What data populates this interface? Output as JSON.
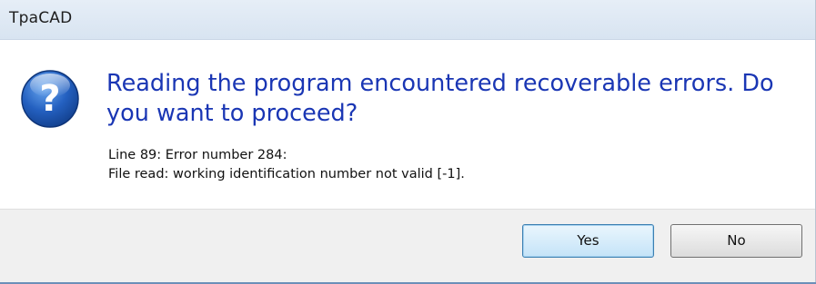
{
  "window": {
    "title": "TpaCAD"
  },
  "message": {
    "icon": "question-icon",
    "main_instruction": "Reading the program encountered recoverable errors. Do you want to proceed?",
    "details": [
      "Line 89: Error number 284:",
      "File read: working identification number not valid [-1]."
    ]
  },
  "buttons": {
    "yes_label": "Yes",
    "no_label": "No"
  },
  "colors": {
    "instruction_text": "#1a36b4",
    "titlebar": "#dce6f2",
    "footer": "#f0f0f0",
    "icon_blue": "#1f58b3"
  }
}
